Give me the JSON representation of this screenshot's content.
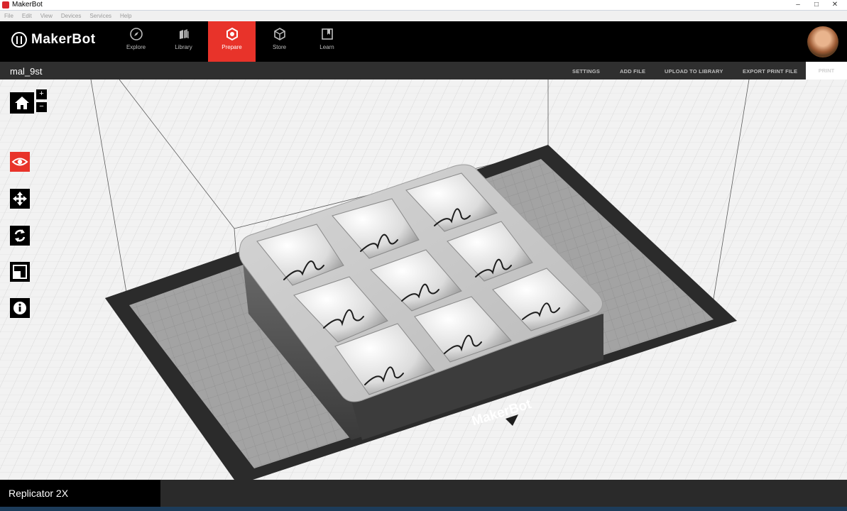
{
  "window": {
    "title": "MakerBot"
  },
  "menubar": [
    "File",
    "Edit",
    "View",
    "Devices",
    "Services",
    "Help"
  ],
  "brand": {
    "name": "MakerBot",
    "accent": "#e8332a"
  },
  "nav": {
    "tabs": [
      {
        "label": "Explore",
        "icon": "compass-icon"
      },
      {
        "label": "Library",
        "icon": "library-icon"
      },
      {
        "label": "Prepare",
        "icon": "prepare-icon",
        "active": true
      },
      {
        "label": "Store",
        "icon": "cube-icon"
      },
      {
        "label": "Learn",
        "icon": "book-icon"
      }
    ]
  },
  "toolbar": {
    "file_name": "mal_9st",
    "settings": "SETTINGS",
    "add_file": "ADD FILE",
    "upload": "UPLOAD TO LIBRARY",
    "export": "EXPORT PRINT FILE",
    "print": "PRINT"
  },
  "view_tools": {
    "home": "home-icon",
    "zoom_in": "+",
    "zoom_out": "−",
    "look": "eye-icon",
    "move": "move-icon",
    "rotate": "rotate-icon",
    "scale": "scale-icon",
    "info": "info-icon"
  },
  "build_plate": {
    "logo_text": "MakerBot"
  },
  "footer": {
    "printer": "Replicator 2X"
  }
}
